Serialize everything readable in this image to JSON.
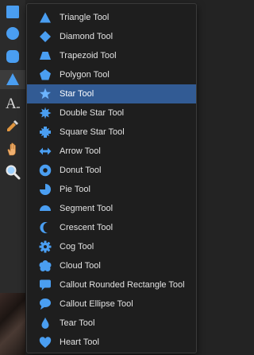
{
  "colors": {
    "accent": "#4a9ef1",
    "selected_row": "#325b94",
    "menu_bg": "#1e1e1e",
    "toolbar_bg": "#2b2b2b"
  },
  "toolbar": {
    "tools": [
      {
        "name": "rectangle-tool",
        "icon": "square-icon"
      },
      {
        "name": "ellipse-tool",
        "icon": "circle-icon"
      },
      {
        "name": "rounded-rectangle-tool",
        "icon": "rounded-square-icon"
      },
      {
        "name": "triangle-tool",
        "icon": "triangle-icon",
        "active": true
      },
      {
        "name": "artistic-text-tool",
        "icon": "text-a-icon"
      },
      {
        "name": "color-picker-tool",
        "icon": "eyedropper-icon"
      },
      {
        "name": "view-tool",
        "icon": "hand-icon"
      },
      {
        "name": "zoom-tool",
        "icon": "magnifier-icon"
      }
    ]
  },
  "menu": {
    "items": [
      {
        "label": "Triangle Tool",
        "icon": "triangle-icon"
      },
      {
        "label": "Diamond Tool",
        "icon": "diamond-icon"
      },
      {
        "label": "Trapezoid Tool",
        "icon": "trapezoid-icon"
      },
      {
        "label": "Polygon Tool",
        "icon": "pentagon-icon"
      },
      {
        "label": "Star Tool",
        "icon": "star-icon",
        "selected": true
      },
      {
        "label": "Double Star Tool",
        "icon": "double-star-icon"
      },
      {
        "label": "Square Star Tool",
        "icon": "square-star-icon"
      },
      {
        "label": "Arrow Tool",
        "icon": "double-arrow-icon"
      },
      {
        "label": "Donut Tool",
        "icon": "donut-icon"
      },
      {
        "label": "Pie Tool",
        "icon": "pie-icon"
      },
      {
        "label": "Segment Tool",
        "icon": "segment-icon"
      },
      {
        "label": "Crescent Tool",
        "icon": "crescent-icon"
      },
      {
        "label": "Cog Tool",
        "icon": "cog-icon"
      },
      {
        "label": "Cloud Tool",
        "icon": "cloud-icon"
      },
      {
        "label": "Callout Rounded Rectangle Tool",
        "icon": "callout-rect-icon"
      },
      {
        "label": "Callout Ellipse Tool",
        "icon": "callout-ellipse-icon"
      },
      {
        "label": "Tear Tool",
        "icon": "tear-icon"
      },
      {
        "label": "Heart Tool",
        "icon": "heart-icon"
      }
    ]
  }
}
